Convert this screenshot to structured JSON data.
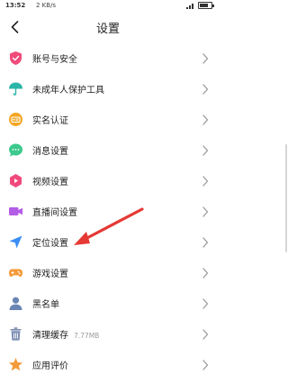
{
  "status_bar": {
    "time": "13:52",
    "network_speed": "2 KB/s"
  },
  "header": {
    "title": "设置"
  },
  "menu": [
    {
      "label": "账号与安全",
      "icon": "shield-icon",
      "color": "#f04b7a"
    },
    {
      "label": "未成年人保护工具",
      "icon": "umbrella-icon",
      "color": "#2bb5a8"
    },
    {
      "label": "实名认证",
      "icon": "id-card-icon",
      "color": "#f5a623"
    },
    {
      "label": "消息设置",
      "icon": "chat-icon",
      "color": "#3cc98c"
    },
    {
      "label": "视频设置",
      "icon": "video-icon",
      "color": "#f0497d"
    },
    {
      "label": "直播间设置",
      "icon": "camera-icon",
      "color": "#b35ce6"
    },
    {
      "label": "定位设置",
      "icon": "location-arrow-icon",
      "color": "#3a8ef6"
    },
    {
      "label": "游戏设置",
      "icon": "gamepad-icon",
      "color": "#f39a3a"
    },
    {
      "label": "黑名单",
      "icon": "user-icon",
      "color": "#6b86b5"
    },
    {
      "label": "清理缓存",
      "sub": "7.77MB",
      "icon": "trash-icon",
      "color": "#7d8fb3"
    },
    {
      "label": "应用评价",
      "icon": "star-icon",
      "color": "#f39a3a"
    }
  ],
  "colors": {
    "annotation_arrow": "#e53935",
    "chevron": "#9a9a9a"
  }
}
